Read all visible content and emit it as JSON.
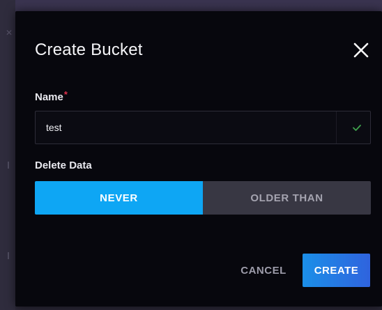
{
  "dialog": {
    "title": "Create Bucket",
    "close_icon": "close-icon"
  },
  "name_field": {
    "label": "Name",
    "required_mark": "*",
    "value": "test",
    "status_icon": "checkmark-icon",
    "status_color": "#3fa34d"
  },
  "delete_data": {
    "label": "Delete Data",
    "options": [
      {
        "label": "NEVER",
        "selected": true
      },
      {
        "label": "OLDER THAN",
        "selected": false
      }
    ]
  },
  "actions": {
    "cancel_label": "CANCEL",
    "create_label": "CREATE"
  },
  "colors": {
    "selected_accent": "#0ea6f4",
    "primary_button_start": "#1b8fe8",
    "primary_button_end": "#2f63de",
    "dialog_bg": "#07070d",
    "required": "#e0304b"
  }
}
